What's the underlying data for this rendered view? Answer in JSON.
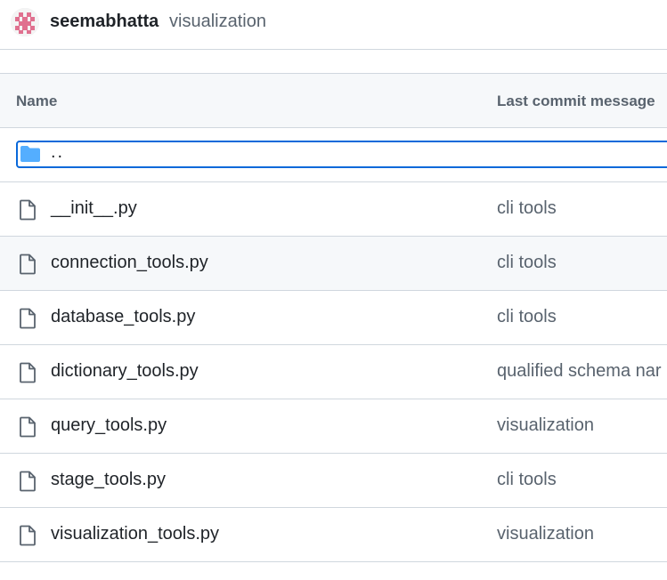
{
  "header": {
    "author": "seemabhatta",
    "commit_message": "visualization"
  },
  "table": {
    "col_name": "Name",
    "col_commit": "Last commit message",
    "parent_label": "..",
    "rows": [
      {
        "name": "__init__.py",
        "commit": "cli tools"
      },
      {
        "name": "connection_tools.py",
        "commit": "cli tools"
      },
      {
        "name": "database_tools.py",
        "commit": "cli tools"
      },
      {
        "name": "dictionary_tools.py",
        "commit": "qualified schema nar"
      },
      {
        "name": "query_tools.py",
        "commit": "visualization"
      },
      {
        "name": "stage_tools.py",
        "commit": "cli tools"
      },
      {
        "name": "visualization_tools.py",
        "commit": "visualization"
      }
    ]
  },
  "colors": {
    "accent": "#0969da",
    "folder": "#54aeff",
    "muted_text": "#59636e",
    "border": "#d0d7de",
    "header_bg": "#f6f8fa"
  },
  "icons": {
    "avatar": "identicon-avatar",
    "parent": "folder-icon",
    "file": "file-icon"
  }
}
